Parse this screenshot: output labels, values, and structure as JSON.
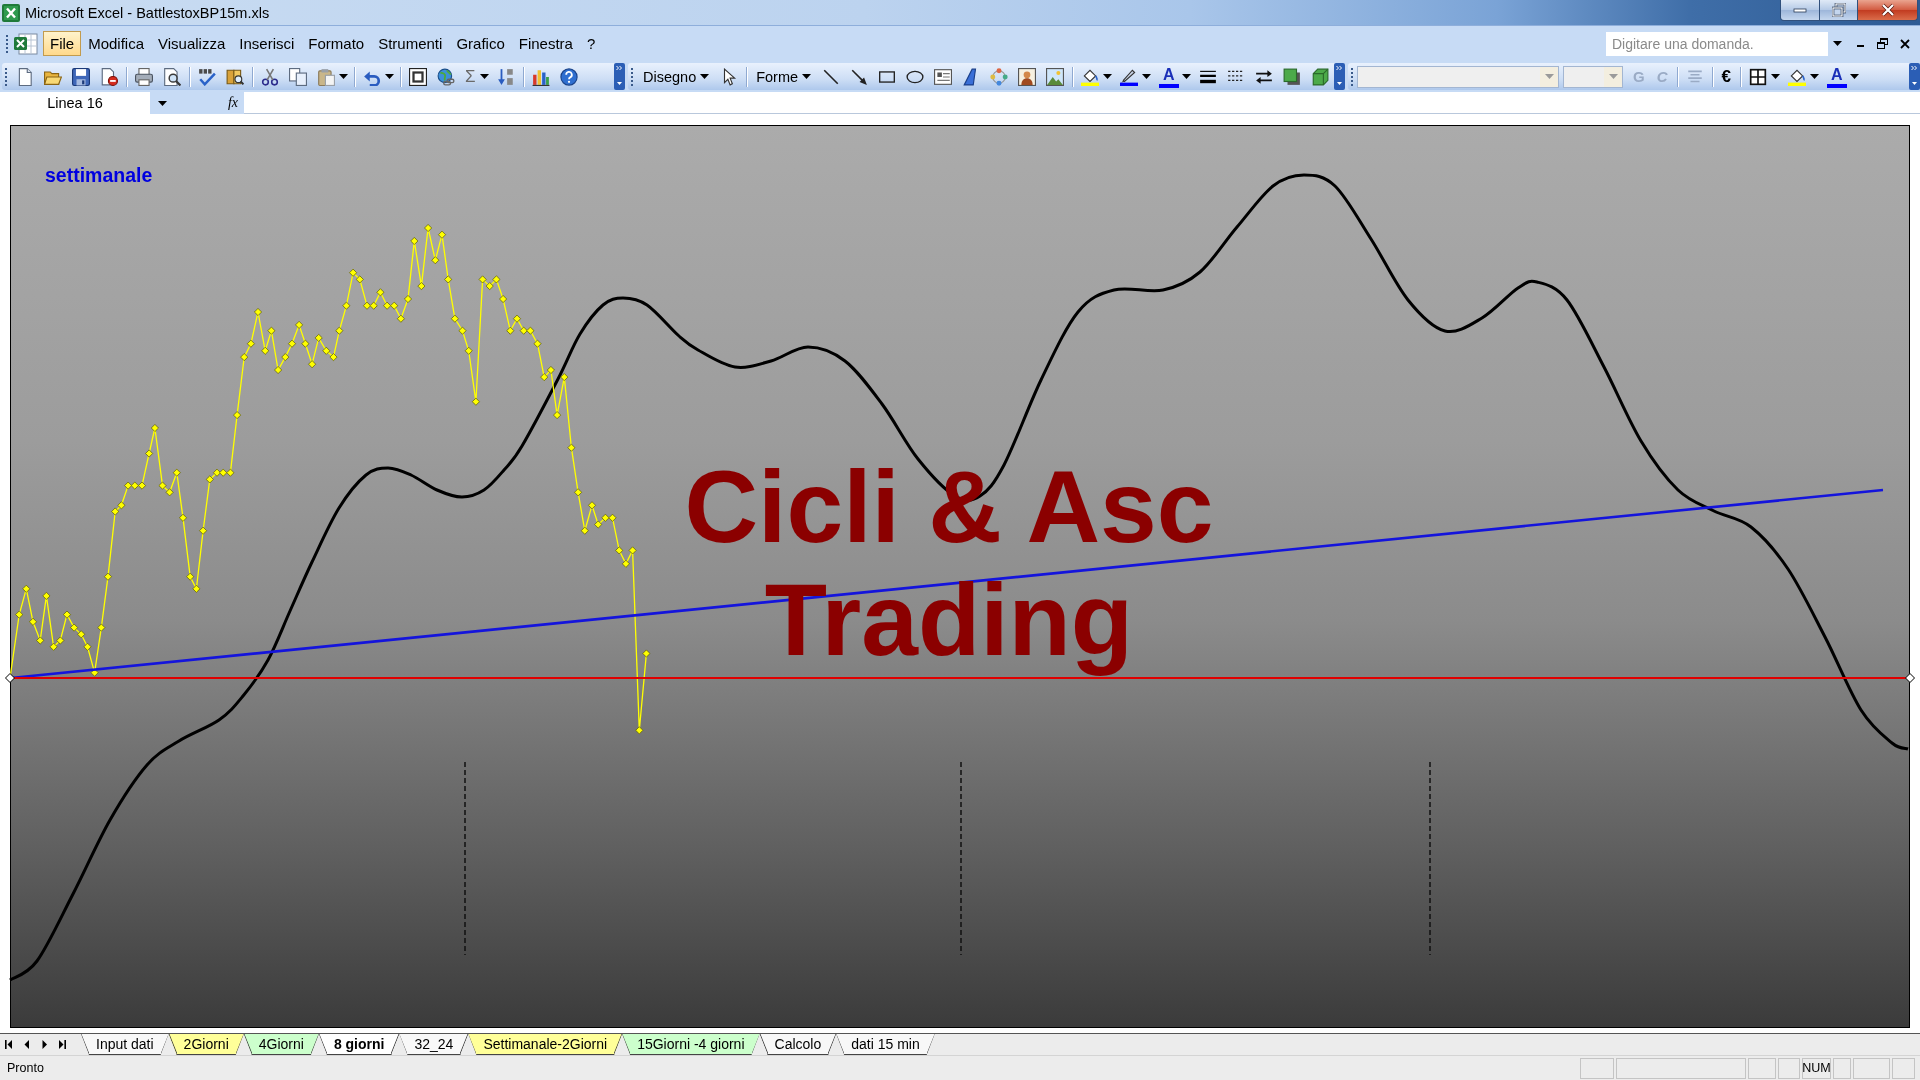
{
  "window": {
    "title": "Microsoft Excel - BattlestoxBP15m.xls"
  },
  "menu_bar": {
    "items": [
      {
        "label": "File",
        "selected": true
      },
      {
        "label": "Modifica",
        "selected": false
      },
      {
        "label": "Visualizza",
        "selected": false
      },
      {
        "label": "Inserisci",
        "selected": false
      },
      {
        "label": "Formato",
        "selected": false
      },
      {
        "label": "Strumenti",
        "selected": false
      },
      {
        "label": "Grafico",
        "selected": false
      },
      {
        "label": "Finestra",
        "selected": false
      },
      {
        "label": "?",
        "selected": false
      }
    ],
    "help_search": {
      "placeholder": "Digitare una domanda."
    }
  },
  "standard_toolbar": {
    "autosum": {
      "label": "Σ"
    }
  },
  "drawing_toolbar": {
    "menus": [
      {
        "label": "Disegno"
      },
      {
        "label": "Forme"
      }
    ],
    "font_color": {
      "label": "A"
    }
  },
  "formatting_toolbar": {
    "font_name": {
      "disabled": true
    },
    "font_size": {
      "disabled": true
    },
    "bold": {
      "label": "G",
      "disabled": true
    },
    "italic": {
      "label": "C",
      "disabled": true
    },
    "center": {
      "disabled": true
    },
    "currency": {
      "label": "€"
    },
    "font_color": {
      "label": "A"
    }
  },
  "formula_bar": {
    "name_box": {
      "value": "Linea 16"
    },
    "function_button": {
      "label": "fx"
    }
  },
  "chart": {
    "title": "settimanale",
    "logo_text": [
      "Cicli & Asc",
      "Trading"
    ],
    "horizontal_line": {
      "selected": true
    }
  },
  "sheet_tabs": [
    {
      "label": "Input dati",
      "selected": false
    },
    {
      "label": "2Giorni",
      "selected": false,
      "color": "#ffff99"
    },
    {
      "label": "4Giorni",
      "selected": false,
      "color": "#ccffcc"
    },
    {
      "label": "8 giorni",
      "selected": true
    },
    {
      "label": "32_24",
      "selected": false
    },
    {
      "label": "Settimanale-2Giorni",
      "selected": false,
      "color": "#ffff99"
    },
    {
      "label": "15Giorni -4 giorni",
      "selected": false,
      "color": "#ccffcc"
    },
    {
      "label": "Calcolo",
      "selected": false
    },
    {
      "label": "dati 15 min",
      "selected": false
    }
  ],
  "status_bar": {
    "message": "Pronto",
    "indicators": [
      "NUM"
    ]
  }
}
